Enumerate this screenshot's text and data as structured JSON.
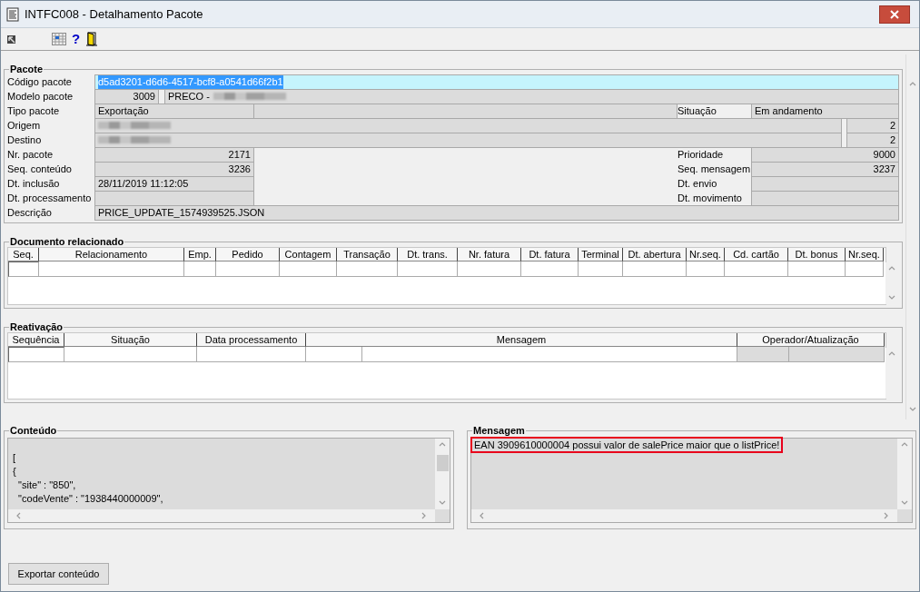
{
  "window": {
    "title": "INTFC008 - Detalhamento Pacote"
  },
  "toolbar": {
    "help": "?"
  },
  "pacote": {
    "title": "Pacote",
    "codigo": {
      "label": "Código pacote",
      "value": "d5ad3201-d6d6-4517-bcf8-a0541d66f2b1",
      "selected": true
    },
    "modelo": {
      "label": "Modelo pacote",
      "code": "3009",
      "name": "PRECO -"
    },
    "tipo": {
      "label": "Tipo pacote",
      "value": "Exportação"
    },
    "situacao": {
      "label": "Situação",
      "value": "Em andamento"
    },
    "origem": {
      "label": "Origem",
      "count": "2"
    },
    "destino": {
      "label": "Destino",
      "count": "2"
    },
    "left_fields": [
      {
        "label": "Nr. pacote",
        "value": "2171",
        "kind": "number"
      },
      {
        "label": "Seq. conteúdo",
        "value": "3236",
        "kind": "number"
      },
      {
        "label": "Dt. inclusão",
        "value": "28/11/2019 11:12:05",
        "kind": "text"
      },
      {
        "label": "Dt. processamento",
        "kind": "text"
      }
    ],
    "right_fields": [
      {
        "label": "Prioridade",
        "value": "9000"
      },
      {
        "label": "Seq. mensagem",
        "value": "3237"
      },
      {
        "label": "Dt. envio"
      },
      {
        "label": "Dt. movimento"
      }
    ],
    "descricao": {
      "label": "Descrição",
      "value": "PRICE_UPDATE_1574939525.JSON"
    }
  },
  "documento": {
    "title": "Documento relacionado",
    "columns": [
      "Seq.",
      "Relacionamento",
      "Emp.",
      "Pedido",
      "Contagem",
      "Transação",
      "Dt. trans.",
      "Nr. fatura",
      "Dt. fatura",
      "Terminal",
      "Dt. abertura",
      "Nr.seq.",
      "Cd. cartão",
      "Dt. bonus",
      "Nr.seq."
    ]
  },
  "reativacao": {
    "title": "Reativação",
    "columns": [
      "Sequência",
      "Situação",
      "Data processamento",
      "Mensagem",
      "Operador/Atualização"
    ]
  },
  "conteudo": {
    "title": "Conteúdo",
    "lines": [
      "[",
      "{",
      "  \"site\" : \"850\",",
      "  \"codeVente\" : \"1938440000009\","
    ]
  },
  "mensagem": {
    "title": "Mensagem",
    "text": "EAN 3909610000004 possui valor de salePrice maior que o listPrice!",
    "highlighted": true
  },
  "buttons": {
    "export": "Exportar conteúdo"
  }
}
